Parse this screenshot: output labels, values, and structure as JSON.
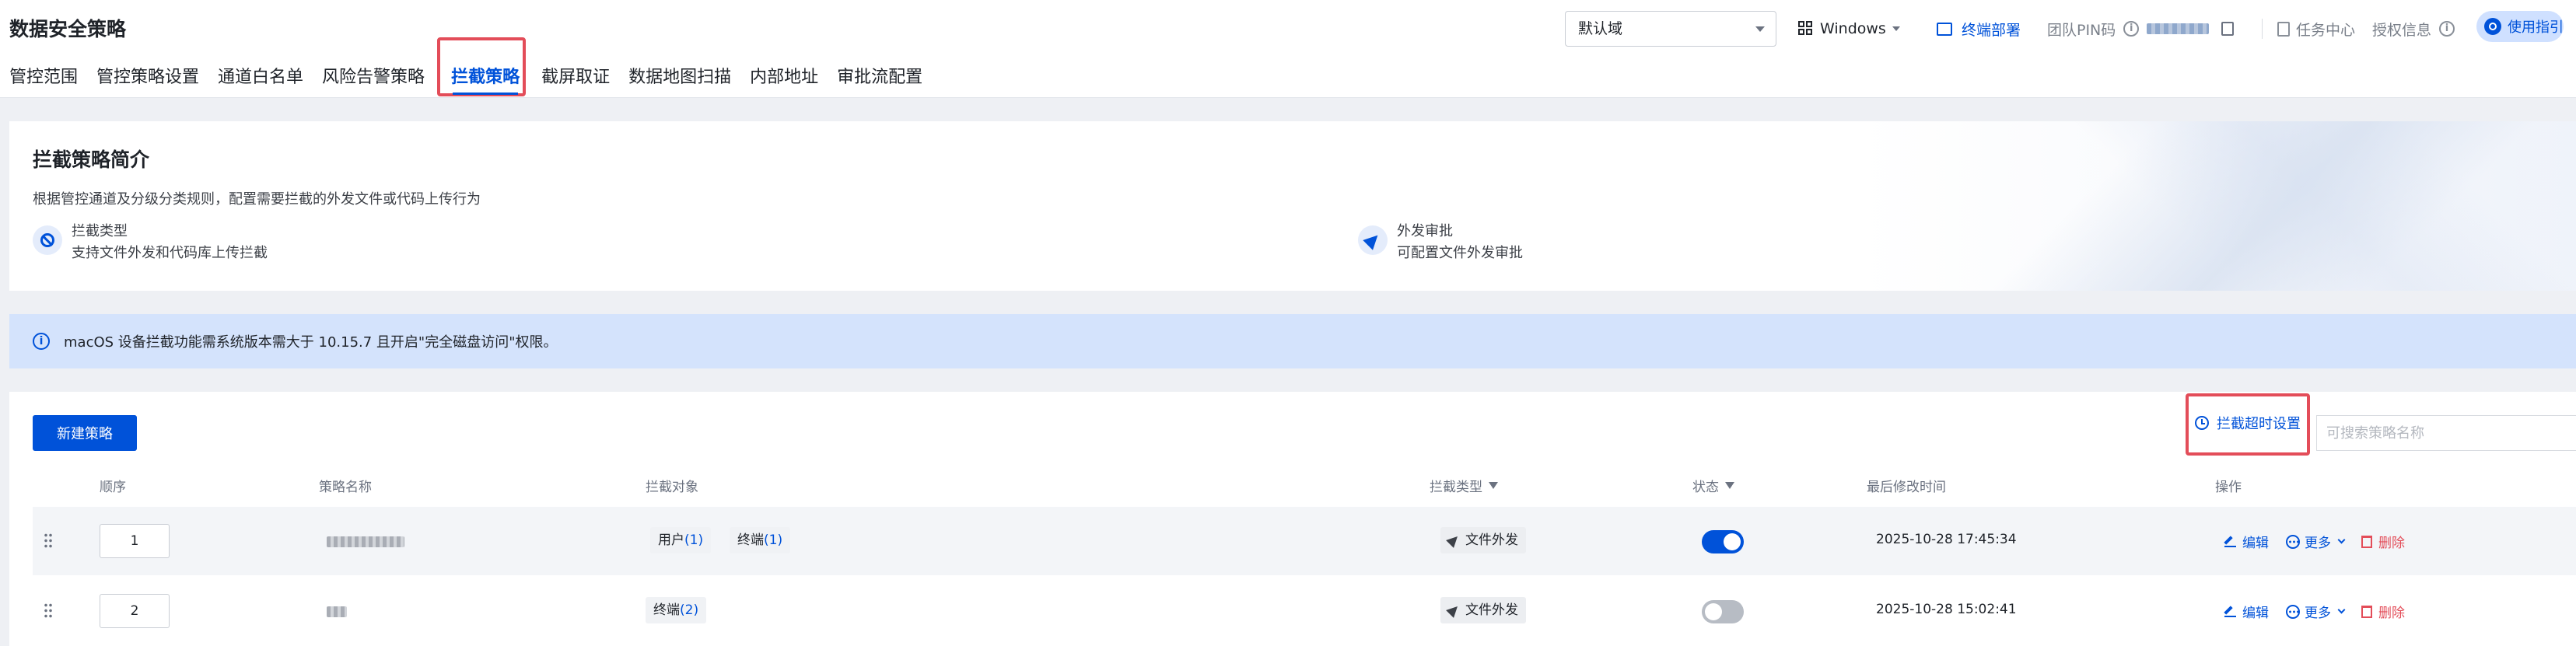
{
  "header": {
    "title": "数据安全策略",
    "tabs": [
      "管控范围",
      "管控策略设置",
      "通道白名单",
      "风险告警策略",
      "拦截策略",
      "截屏取证",
      "数据地图扫描",
      "内部地址",
      "审批流配置"
    ],
    "active_tab": "拦截策略",
    "domain_select": "默认域",
    "os_select": "Windows",
    "deploy_link": "终端部署",
    "pin_label": "团队PIN码",
    "task_center": "任务中心",
    "auth_info": "授权信息",
    "guide_button": "使用指引"
  },
  "intro": {
    "title": "拦截策略简介",
    "description": "根据管控通道及分级分类规则，配置需要拦截的外发文件或代码上传行为",
    "features": [
      {
        "title": "拦截类型",
        "desc": "支持文件外发和代码库上传拦截",
        "icon": "ban-icon"
      },
      {
        "title": "外发审批",
        "desc": "可配置文件外发审批",
        "icon": "send-icon"
      }
    ]
  },
  "notice": {
    "text": "macOS 设备拦截功能需系统版本需大于 10.15.7 且开启\"完全磁盘访问\"权限。"
  },
  "table": {
    "new_button": "新建策略",
    "timeout_button": "拦截超时设置",
    "search_placeholder": "可搜索策略名称",
    "columns": {
      "order": "顺序",
      "name": "策略名称",
      "target": "拦截对象",
      "type": "拦截类型",
      "status": "状态",
      "modified": "最后修改时间",
      "actions": "操作"
    },
    "rows": [
      {
        "order": "1",
        "targets": [
          {
            "label": "用户",
            "count": "(1)"
          },
          {
            "label": "终端",
            "count": "(1)"
          }
        ],
        "type": "文件外发",
        "enabled": true,
        "modified": "2025-10-28 17:45:34"
      },
      {
        "order": "2",
        "targets": [
          {
            "label": "终端",
            "count": "(2)"
          }
        ],
        "type": "文件外发",
        "enabled": false,
        "modified": "2025-10-28 15:02:41"
      }
    ],
    "actions": {
      "edit": "编辑",
      "more": "更多",
      "delete": "删除"
    }
  },
  "colors": {
    "primary": "#0052d9",
    "danger": "#e34d59",
    "highlight_box": "#e34d59",
    "notice_bg": "#d4e3fc"
  }
}
